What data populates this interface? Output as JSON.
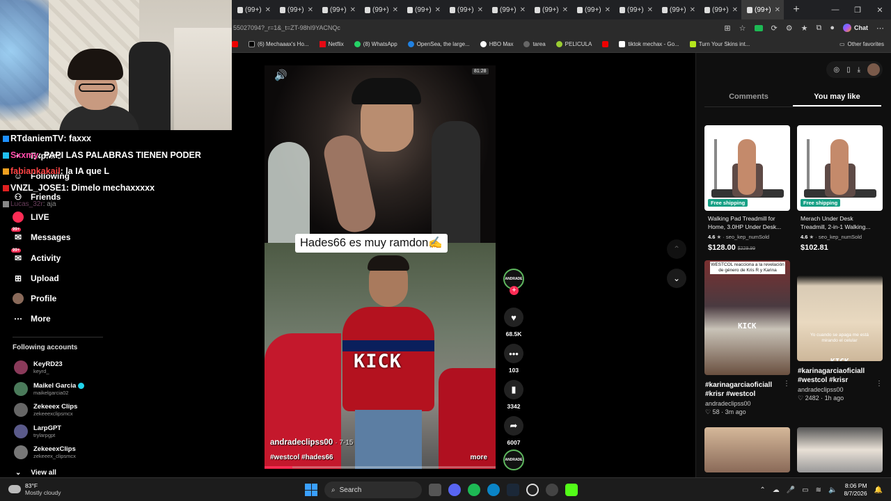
{
  "browser": {
    "tab_label": "(99+)",
    "tab_count": 13,
    "url": "55027094?_r=1&_t=ZT-98hI9YACNQc",
    "chat_label": "Chat",
    "bookmarks": [
      {
        "label": "",
        "icon": "youtube-icon",
        "cls": "bm-red"
      },
      {
        "label": "(6) Mechaaax's Ho...",
        "icon": "x-icon",
        "cls": "bm-x"
      },
      {
        "label": "Netflix",
        "icon": "netflix-icon",
        "cls": "bm-netflix"
      },
      {
        "label": "(8) WhatsApp",
        "icon": "whatsapp-icon",
        "cls": "bm-wa"
      },
      {
        "label": "OpenSea, the large...",
        "icon": "opensea-icon",
        "cls": "bm-os"
      },
      {
        "label": "HBO Max",
        "icon": "hbo-icon",
        "cls": "bm-hbo"
      },
      {
        "label": "tarea",
        "icon": "tarea-icon",
        "cls": "bm-tarea"
      },
      {
        "label": "PELICULA",
        "icon": "pelicula-icon",
        "cls": "bm-pel"
      },
      {
        "label": "",
        "icon": "youtube-icon",
        "cls": "bm-yt"
      },
      {
        "label": "tiktok mechax - Go...",
        "icon": "tiktok-icon",
        "cls": "bm-tt"
      },
      {
        "label": "Turn Your Skins int...",
        "icon": "skins-icon",
        "cls": "bm-skins"
      }
    ],
    "other_favorites": "Other favorites"
  },
  "stream_chat": [
    {
      "user": "RTdaniemTV",
      "message": ": faxxx",
      "cls": "user1"
    },
    {
      "user": "Sxxmy",
      "message": ": PAPI LAS PALABRAS TIENEN PODER",
      "cls": "user2"
    },
    {
      "user": "fabiankakail",
      "message": ": la IA que L",
      "cls": "user3"
    },
    {
      "user": "VNZL_JOSE1",
      "message": ": Dimelo mechaxxxxx",
      "cls": "user4"
    },
    {
      "user": "Lucas_32r",
      "message": ": aja",
      "cls": "user5"
    }
  ],
  "sidebar": {
    "nav": [
      {
        "label": "Explore",
        "icon": "compass-icon"
      },
      {
        "label": "Following",
        "icon": "following-icon"
      },
      {
        "label": "Friends",
        "icon": "friends-icon"
      },
      {
        "label": "LIVE",
        "icon": "live-icon"
      },
      {
        "label": "Messages",
        "icon": "messages-icon",
        "badge": "99+"
      },
      {
        "label": "Activity",
        "icon": "activity-icon",
        "badge": "99+"
      },
      {
        "label": "Upload",
        "icon": "upload-icon"
      },
      {
        "label": "Profile",
        "icon": "profile-icon"
      },
      {
        "label": "More",
        "icon": "more-icon"
      }
    ],
    "following_title": "Following accounts",
    "accounts": [
      {
        "name": "KeyRD23",
        "handle": "keyrd_",
        "verified": false
      },
      {
        "name": "Maikel Garcia",
        "handle": "maikelgarcia02",
        "verified": true
      },
      {
        "name": "Zekeeex Clips",
        "handle": "zekeeexclipsmcx",
        "verified": false
      },
      {
        "name": "LarpGPT",
        "handle": "trylarpgpt",
        "verified": false
      },
      {
        "name": "ZekeeexClips",
        "handle": "zekeeex_clipsmcx",
        "verified": false
      }
    ],
    "view_all": "View all"
  },
  "video": {
    "caption": "Hades66 es muy ramdon✍️",
    "watermark": "KICK",
    "author": "andradeclipss00",
    "date": "· 7-15",
    "tags": "#westcol #hades66",
    "more": "more",
    "progress": 0.12,
    "top_badge": "81:28",
    "avatar_text": "ANDRADE",
    "likes": "68.5K",
    "comments": "103",
    "saves": "3342",
    "shares": "6007"
  },
  "right_panel": {
    "tabs": [
      "Comments",
      "You may like"
    ],
    "active_tab": 1,
    "products": [
      {
        "badge": "Free shipping",
        "title": "Walking Pad Treadmill for Home, 3.0HP Under Desk...",
        "rating": "4.6",
        "sold": "seo_kep_numSold",
        "price": "$128.00",
        "old_price": "$229.99"
      },
      {
        "badge": "Free shipping",
        "title": "Merach Under Desk Treadmill, 2-in-1 Walking...",
        "rating": "4.6",
        "sold": "seo_kep_numSold",
        "price": "$102.81",
        "old_price": ""
      }
    ],
    "videos": [
      {
        "overlay": "WESTCOL reacciona a la revelación de género de Kris R y Karina",
        "watermark": "KICK",
        "title": "#karinagarciaoficiall #krisr #westcol",
        "author": "andradeclipss00",
        "likes": "58",
        "ago": "3m ago"
      },
      {
        "overlay": "Yo cuando se apaga me está mirando el celular",
        "watermark": "KICK",
        "title": "#karinagarciaoficiall #westcol #krisr",
        "author": "andradeclipss00",
        "likes": "2482",
        "ago": "1h ago"
      }
    ]
  },
  "taskbar": {
    "temp": "83°F",
    "condition": "Mostly cloudy",
    "search": "Search",
    "time": "8:06 PM",
    "date": "8/7/2026"
  }
}
